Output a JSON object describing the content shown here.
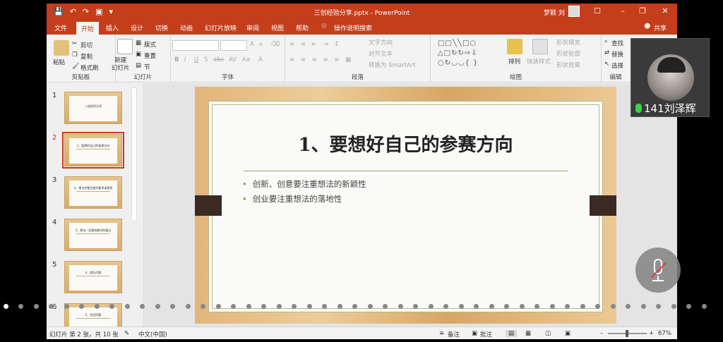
{
  "window": {
    "title": "三创经验分享.pptx - PowerPoint",
    "user": "梦颖 刘",
    "qat_icons": [
      "save-icon",
      "undo-icon",
      "redo-icon",
      "present-icon",
      "customize-icon"
    ],
    "controls": [
      "ribbon-display-icon",
      "minimize-icon",
      "restore-icon",
      "close-icon"
    ]
  },
  "tabs": [
    "文件",
    "开始",
    "插入",
    "设计",
    "切换",
    "动画",
    "幻灯片放映",
    "审阅",
    "视图",
    "帮助"
  ],
  "active_tab": "开始",
  "tell_me": "操作说明搜索",
  "share": "共享",
  "ribbon": {
    "clipboard": {
      "label": "剪贴板",
      "paste": "粘贴",
      "cut": "剪切",
      "copy": "复制",
      "format_painter": "格式刷"
    },
    "slides": {
      "label": "幻灯片",
      "new_slide": "新建\n幻灯片",
      "layout": "版式",
      "reset": "重置",
      "section": "节"
    },
    "font": {
      "label": "字体",
      "bold": "B",
      "italic": "I",
      "underline": "U",
      "strike": "S",
      "shadow": "abc",
      "spacing": "AV",
      "case": "Aa",
      "color": "A",
      "grow": "A",
      "shrink": "A"
    },
    "paragraph": {
      "label": "段落",
      "text_direction": "文字方向",
      "align_text": "对齐文本",
      "smartart": "转换为 SmartArt"
    },
    "drawing": {
      "label": "绘图",
      "arrange": "排列",
      "quick_styles": "快速样式",
      "fill": "形状填充",
      "outline": "形状轮廓",
      "effects": "形状效果"
    },
    "editing": {
      "label": "编辑",
      "find": "查找",
      "replace": "替换",
      "select": "选择"
    }
  },
  "thumbnails": [
    {
      "num": "1",
      "title": "三创经验分享"
    },
    {
      "num": "2",
      "title": "1、要想好自己的参赛方向"
    },
    {
      "num": "3",
      "title": "2、想法完整且细节要考虑周到"
    },
    {
      "num": "4",
      "title": "3、想法一定要有解决的痛点"
    },
    {
      "num": "5",
      "title": "4、团队问题"
    },
    {
      "num": "6",
      "title": "5、项目问题"
    }
  ],
  "selected_slide": 2,
  "slide": {
    "title": "1、要想好自己的参赛方向",
    "bullets": [
      "创新、创意要注重想法的新颖性",
      "创业要注重想法的落地性"
    ]
  },
  "status": {
    "slide_info": "幻灯片 第 2 张，共 10 张",
    "language": "中文(中国)",
    "notes": "备注",
    "comments": "批注",
    "zoom": "67%"
  },
  "meeting": {
    "participant_label": "141刘泽辉",
    "mic_state": "muted"
  },
  "colors": {
    "accent": "#c43e1c",
    "mic_green": "#3ccf4e",
    "mute_red": "#e0413a"
  },
  "pagination": {
    "total": 47,
    "current": 1
  }
}
